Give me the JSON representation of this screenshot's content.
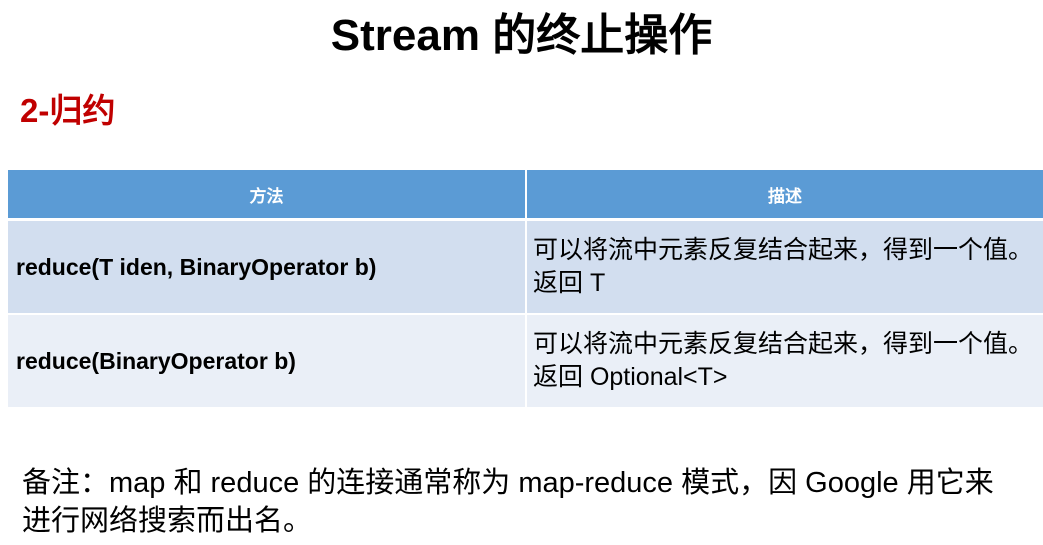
{
  "title": "Stream 的终止操作",
  "section_heading": "2-归约",
  "table": {
    "headers": [
      "方法",
      "描述"
    ],
    "rows": [
      {
        "method": "reduce(T iden, BinaryOperator b)",
        "description": "可以将流中元素反复结合起来，得到一个值。返回 T"
      },
      {
        "method": "reduce(BinaryOperator b)",
        "description": "可以将流中元素反复结合起来，得到一个值。返回 Optional<T>"
      }
    ]
  },
  "footnote": "备注：map 和 reduce 的连接通常称为 map-reduce 模式，因 Google 用它来进行网络搜索而出名。",
  "colors": {
    "header_bg": "#5b9bd5",
    "row_bg": "#d2deef",
    "row_alt_bg": "#eaeff7",
    "heading_red": "#c00000"
  }
}
